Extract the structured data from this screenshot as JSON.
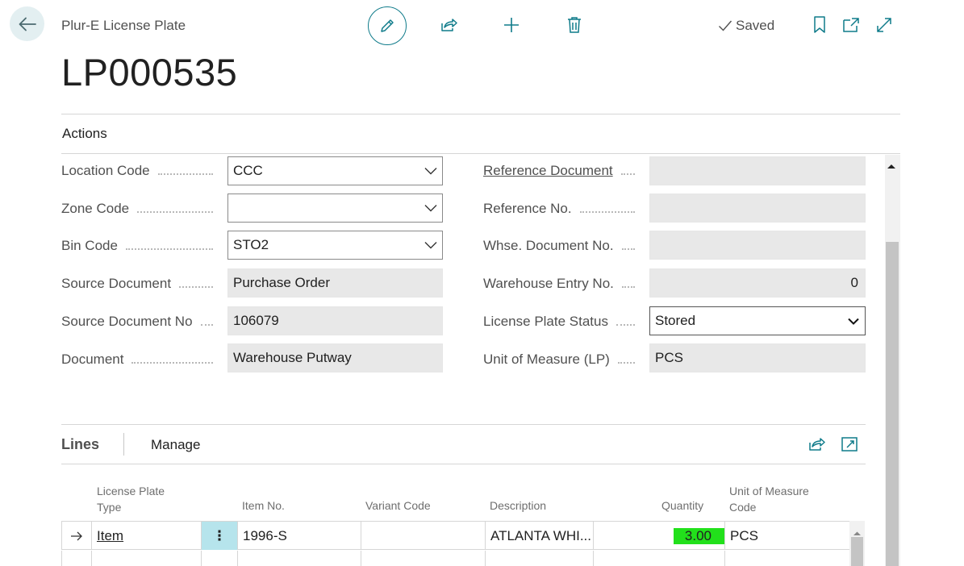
{
  "header": {
    "caption": "Plur-E License Plate",
    "record_title": "LP000535",
    "saved_label": "Saved",
    "toolbar_icons": [
      "edit-icon",
      "share-icon",
      "plus-icon",
      "delete-icon",
      "bookmark-icon",
      "open-new-window-icon",
      "expand-icon"
    ]
  },
  "actions_label": "Actions",
  "fields_left": [
    {
      "label": "Location Code",
      "value": "CCC",
      "type": "dropdown"
    },
    {
      "label": "Zone Code",
      "value": "",
      "type": "dropdown"
    },
    {
      "label": "Bin Code",
      "value": "STO2",
      "type": "dropdown"
    },
    {
      "label": "Source Document",
      "value": "Purchase Order",
      "type": "readonly"
    },
    {
      "label": "Source Document No",
      "value": "106079",
      "type": "readonly"
    },
    {
      "label": "Document",
      "value": "Warehouse Putway",
      "type": "readonly"
    }
  ],
  "fields_right": [
    {
      "label": "Reference Document",
      "value": "",
      "type": "readonly"
    },
    {
      "label": "Reference No.",
      "value": "",
      "type": "readonly"
    },
    {
      "label": "Whse. Document No.",
      "value": "",
      "type": "readonly"
    },
    {
      "label": "Warehouse Entry No.",
      "value": "0",
      "type": "readonly"
    },
    {
      "label": "License Plate Status",
      "value": "Stored",
      "type": "select"
    },
    {
      "label": "Unit of Measure (LP)",
      "value": "PCS",
      "type": "readonly"
    }
  ],
  "lines": {
    "title": "Lines",
    "manage_label": "Manage",
    "columns": [
      "License Plate Type",
      "Item No.",
      "Variant Code",
      "Description",
      "Quantity",
      "Unit of Measure Code"
    ],
    "column_header_lines": {
      "type_1": "License Plate",
      "type_2": "Type",
      "uom_1": "Unit of Measure",
      "uom_2": "Code"
    },
    "rows": [
      {
        "type": "Item",
        "item_no": "1996-S",
        "variant_code": "",
        "description": "ATLANTA WHI...",
        "quantity": "3.00",
        "uom": "PCS"
      }
    ]
  },
  "colors": {
    "accent": "#0f7b8a",
    "back_bg": "#e3eff1",
    "quantity_highlight": "#22e01b",
    "selected_cell": "#b6e4ec"
  }
}
